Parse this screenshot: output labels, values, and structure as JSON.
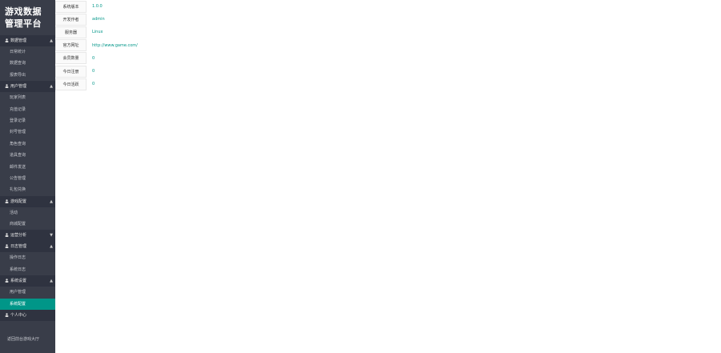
{
  "app": {
    "title_line1": "游戏数据",
    "title_line2": "管理平台"
  },
  "sidebar": {
    "groups": [
      {
        "label": "数据管理",
        "arrow": "▲",
        "items": [
          {
            "label": "日常统计"
          },
          {
            "label": "数据查询"
          },
          {
            "label": "报表导出"
          }
        ]
      },
      {
        "label": "用户管理",
        "arrow": "▲",
        "items": [
          {
            "label": "玩家列表"
          },
          {
            "label": "充值记录"
          },
          {
            "label": "登录记录"
          },
          {
            "label": "封号管理"
          },
          {
            "label": "角色查询"
          },
          {
            "label": "道具查询"
          },
          {
            "label": "邮件发送"
          },
          {
            "label": "公告管理"
          },
          {
            "label": "礼包兑换"
          }
        ]
      },
      {
        "label": "游戏配置",
        "arrow": "▲",
        "items": [
          {
            "label": "活动"
          },
          {
            "label": "商城配置"
          }
        ]
      },
      {
        "label": "运营分析",
        "arrow": "▼",
        "items": []
      },
      {
        "label": "日志管理",
        "arrow": "▲",
        "items": [
          {
            "label": "操作日志"
          },
          {
            "label": "系统日志"
          }
        ]
      },
      {
        "label": "系统设置",
        "arrow": "▲",
        "items": [
          {
            "label": "用户管理"
          },
          {
            "label": "系统配置",
            "active": true
          }
        ]
      },
      {
        "label": "个人中心",
        "arrow": "",
        "items": []
      }
    ],
    "footer": "返回前台游戏大厅"
  },
  "info_table": {
    "rows": [
      {
        "label": "系统版本",
        "value": "1.0.0"
      },
      {
        "label": "开发作者",
        "value": "admin"
      },
      {
        "label": "服务器",
        "value": "Linux"
      },
      {
        "label": "官方网址",
        "value": "http://www.game.com/"
      },
      {
        "label": "会员数量",
        "value": "0"
      },
      {
        "label": "今日注册",
        "value": "0"
      },
      {
        "label": "今日活跃",
        "value": "0"
      }
    ]
  },
  "colors": {
    "sidebar_bg": "#393d49",
    "section_bg": "#2f3340",
    "accent": "#009688"
  }
}
